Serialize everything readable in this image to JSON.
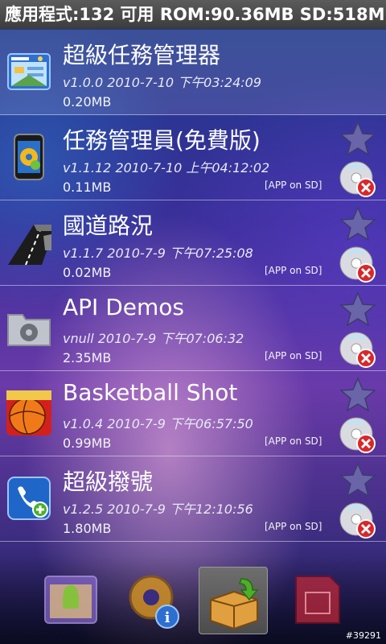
{
  "status_bar": {
    "text": "應用程式:132 可用 ROM:90.36MB SD:518MB"
  },
  "apps": [
    {
      "name": "超級任務管理器",
      "version": "v1.0.0 2010-7-10 下午03:24:09",
      "size": "0.20MB",
      "sd_label": "",
      "icon": "task-manager-window-icon"
    },
    {
      "name": "任務管理員(免費版)",
      "version": "v1.1.12 2010-7-10 上午04:12:02",
      "size": "0.11MB",
      "sd_label": "[APP on SD]",
      "icon": "phone-gear-icon"
    },
    {
      "name": "國道路況",
      "version": "v1.1.7 2010-7-9 下午07:25:08",
      "size": "0.02MB",
      "sd_label": "[APP on SD]",
      "icon": "highway-road-icon"
    },
    {
      "name": "API Demos",
      "version": "vnull 2010-7-9 下午07:06:32",
      "size": "2.35MB",
      "sd_label": "[APP on SD]",
      "icon": "folder-gear-icon"
    },
    {
      "name": "Basketball Shot",
      "version": "v1.0.4 2010-7-9 下午06:57:50",
      "size": "0.99MB",
      "sd_label": "[APP on SD]",
      "icon": "basketball-icon"
    },
    {
      "name": "超級撥號",
      "version": "v1.2.5 2010-7-9 下午12:10:56",
      "size": "1.80MB",
      "sd_label": "[APP on SD]",
      "icon": "phone-dialer-icon"
    }
  ],
  "bottom_tabs": [
    {
      "icon": "android-apps-window-icon",
      "selected": false
    },
    {
      "icon": "gear-info-icon",
      "selected": false
    },
    {
      "icon": "install-box-icon",
      "selected": true
    },
    {
      "icon": "sd-card-icon",
      "selected": false
    }
  ],
  "watermark": "#39291",
  "colors": {
    "status_bar": "#4a4a4a",
    "uninstall_badge": "#d8282a",
    "star": "#6a64a8"
  }
}
